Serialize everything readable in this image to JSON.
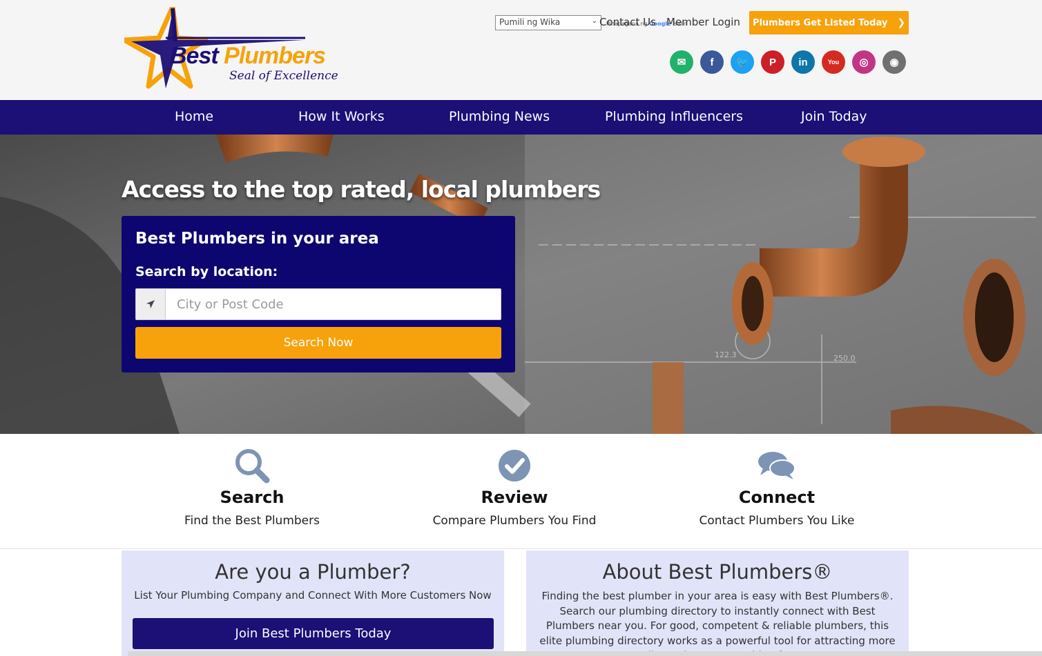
{
  "header": {
    "brand_name": "Best Plumbers",
    "brand_tagline": "Seal of Excellence",
    "language_select": "Pumili ng Wika",
    "translate_credit_prefix": "Pinapagana ng",
    "translate_credit_brand": "Google",
    "translate_credit_suffix": "Isalin",
    "contact_link": "Contact Us",
    "login_link": "Member Login",
    "cta_label": "Plumbers Get Listed Today",
    "socials": [
      {
        "icon": "envelope-icon",
        "glyph": "✉",
        "color": "#20b26b"
      },
      {
        "icon": "facebook-icon",
        "glyph": "f",
        "color": "#3b5998"
      },
      {
        "icon": "twitter-icon",
        "glyph": "🐦",
        "color": "#1da1f2"
      },
      {
        "icon": "pinterest-icon",
        "glyph": "P",
        "color": "#cb2027"
      },
      {
        "icon": "linkedin-icon",
        "glyph": "in",
        "color": "#0e76a8"
      },
      {
        "icon": "youtube-icon",
        "glyph": "You",
        "color": "#d52a22"
      },
      {
        "icon": "instagram-icon",
        "glyph": "◎",
        "color": "#c13584"
      },
      {
        "icon": "rss-icon",
        "glyph": "◉",
        "color": "#707070"
      }
    ]
  },
  "nav": {
    "items": [
      "Home",
      "How It Works",
      "Plumbing News",
      "Plumbing Influencers",
      "Join Today"
    ]
  },
  "hero": {
    "title": "Access to the top rated, local plumbers",
    "card_title": "Best Plumbers in your area",
    "search_label": "Search by location:",
    "search_placeholder": "City or Post Code",
    "search_button": "Search Now"
  },
  "features": [
    {
      "title": "Search",
      "subtitle": "Find the Best Plumbers"
    },
    {
      "title": "Review",
      "subtitle": "Compare Plumbers You Find"
    },
    {
      "title": "Connect",
      "subtitle": "Contact Plumbers You Like"
    }
  ],
  "plumber_panel": {
    "title": "Are you a Plumber?",
    "subtitle": "List Your Plumbing Company and Connect With More Customers Now",
    "button": "Join Best Plumbers Today"
  },
  "about_panel": {
    "title": "About Best Plumbers®",
    "text": "Finding the best plumber in your area is easy with Best Plumbers®. Search our plumbing directory to instantly connect with Best Plumbers near you. For good, competent & reliable plumbers, this elite plumbing directory works as a powerful tool for attracting more clients that are searching for"
  },
  "colors": {
    "nav": "#1c0f75",
    "accent": "#f7a10b",
    "card": "#0d0670",
    "panel": "#e1e4f9",
    "feature_icon": "#7d94b5"
  }
}
